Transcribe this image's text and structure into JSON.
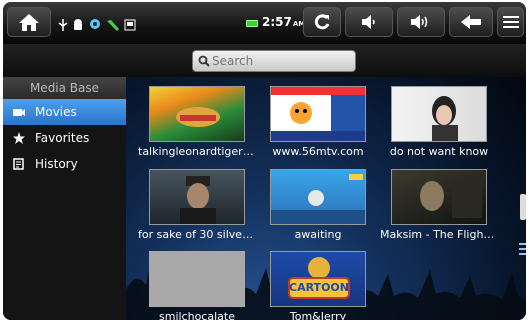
{
  "statusbar": {
    "time": "2:57",
    "ampm": "AM",
    "icons": [
      "home-icon",
      "usb-icon",
      "android-icon",
      "settings-icon",
      "phone-icon",
      "sdcard-icon",
      "battery-icon",
      "refresh-icon",
      "volume-down-icon",
      "volume-up-icon",
      "back-icon",
      "menu-icon"
    ]
  },
  "search": {
    "placeholder": "Search"
  },
  "sidebar": {
    "header": "Media Base",
    "items": [
      {
        "label": "Movies",
        "icon": "movie-icon",
        "active": true
      },
      {
        "label": "Favorites",
        "icon": "star-icon",
        "active": false
      },
      {
        "label": "History",
        "icon": "history-icon",
        "active": false
      }
    ]
  },
  "videos": [
    {
      "title": "talkingleonardtigerf..."
    },
    {
      "title": "www.56mtv.com"
    },
    {
      "title": "do not want know"
    },
    {
      "title": "for sake of 30 silver ..."
    },
    {
      "title": "awaiting"
    },
    {
      "title": "Maksim - The Flight ..."
    },
    {
      "title": "smilchocalate"
    },
    {
      "title": "Tom&Jerry",
      "thumb_text": "CARTOON"
    }
  ],
  "colors": {
    "active": "#3a8ae0",
    "battery": "#39d13a"
  }
}
